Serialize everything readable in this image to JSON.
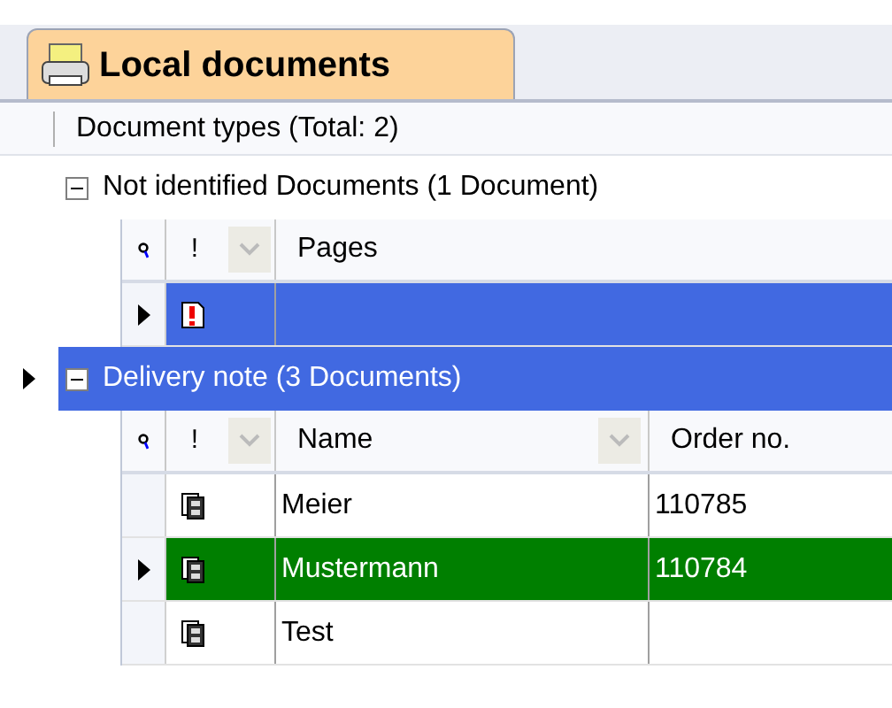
{
  "tab": {
    "label": "Local documents",
    "selected": true
  },
  "header": "Document types (Total: 2)",
  "groups": [
    {
      "label": "Not identified Documents (1 Document)",
      "expanded": true,
      "selected": false,
      "current": false,
      "flag_column": "!",
      "columns": [
        {
          "label": "Pages",
          "filter": false
        }
      ],
      "rows": [
        {
          "kind": "warning",
          "cells": [],
          "selected": true,
          "current": true
        }
      ]
    },
    {
      "label": "Delivery note (3 Documents)",
      "expanded": true,
      "selected": true,
      "current": true,
      "flag_column": "!",
      "columns": [
        {
          "label": "Name",
          "filter": true
        },
        {
          "label": "Order no.",
          "filter": false
        }
      ],
      "rows": [
        {
          "kind": "document",
          "cells": [
            "Meier",
            "110785"
          ],
          "selected": false,
          "current": false
        },
        {
          "kind": "document",
          "cells": [
            "Mustermann",
            "110784"
          ],
          "selected": true,
          "current": true
        },
        {
          "kind": "document",
          "cells": [
            "Test",
            ""
          ],
          "selected": false,
          "current": false
        }
      ]
    }
  ]
}
